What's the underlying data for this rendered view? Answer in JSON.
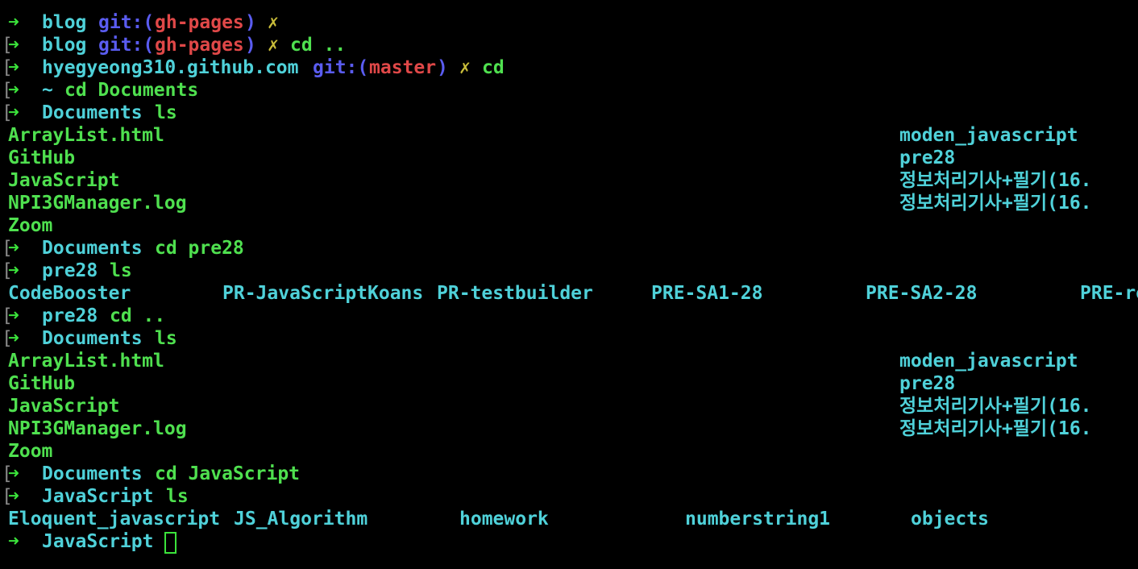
{
  "colors": {
    "background": "#000000",
    "prompt_arrow": "#3be33b",
    "directory": "#4fd1d9",
    "git_label": "#5a5cf0",
    "branch": "#e04848",
    "dirty_mark": "#c9bd3a",
    "command": "#4fe04f",
    "file": "#4fe04f",
    "folder": "#4fd1d9"
  },
  "prompt": {
    "arrow": "➜",
    "bracket": "[",
    "dirty_mark": "✗"
  },
  "lines": [
    {
      "dir": "blog",
      "git_label": "git:(",
      "branch": "gh-pages",
      "git_close": ")",
      "cmd": ""
    },
    {
      "dir": "blog",
      "git_label": "git:(",
      "branch": "gh-pages",
      "git_close": ")",
      "cmd": "cd .."
    },
    {
      "dir": "hyegyeong310.github.com",
      "git_label": "git:(",
      "branch": "master",
      "git_close": ")",
      "cmd": "cd"
    },
    {
      "dir": "~",
      "cmd": "cd Documents"
    },
    {
      "dir": "Documents",
      "cmd": "ls"
    },
    {
      "dir": "Documents",
      "cmd": "cd pre28"
    },
    {
      "dir": "pre28",
      "cmd": "ls"
    },
    {
      "dir": "pre28",
      "cmd": "cd .."
    },
    {
      "dir": "Documents",
      "cmd": "ls"
    },
    {
      "dir": "Documents",
      "cmd": "cd JavaScript"
    },
    {
      "dir": "JavaScript",
      "cmd": "ls"
    },
    {
      "dir": "JavaScript",
      "cmd": ""
    }
  ],
  "documents_ls": {
    "left": [
      "ArrayList.html",
      "GitHub",
      "JavaScript",
      "NPI3GManager.log",
      "Zoom"
    ],
    "right": [
      "moden_javascript",
      "pre28",
      "정보처리기사+필기(16.",
      "정보처리기사+필기(16."
    ]
  },
  "pre28_ls": [
    "CodeBooster",
    "PR-JavaScriptKoans",
    "PR-testbuilder",
    "PRE-SA1-28",
    "PRE-SA2-28",
    "PRE-re"
  ],
  "javascript_ls": [
    "Eloquent_javascript",
    "JS_Algorithm",
    "homework",
    "numberstring1",
    "objects"
  ]
}
